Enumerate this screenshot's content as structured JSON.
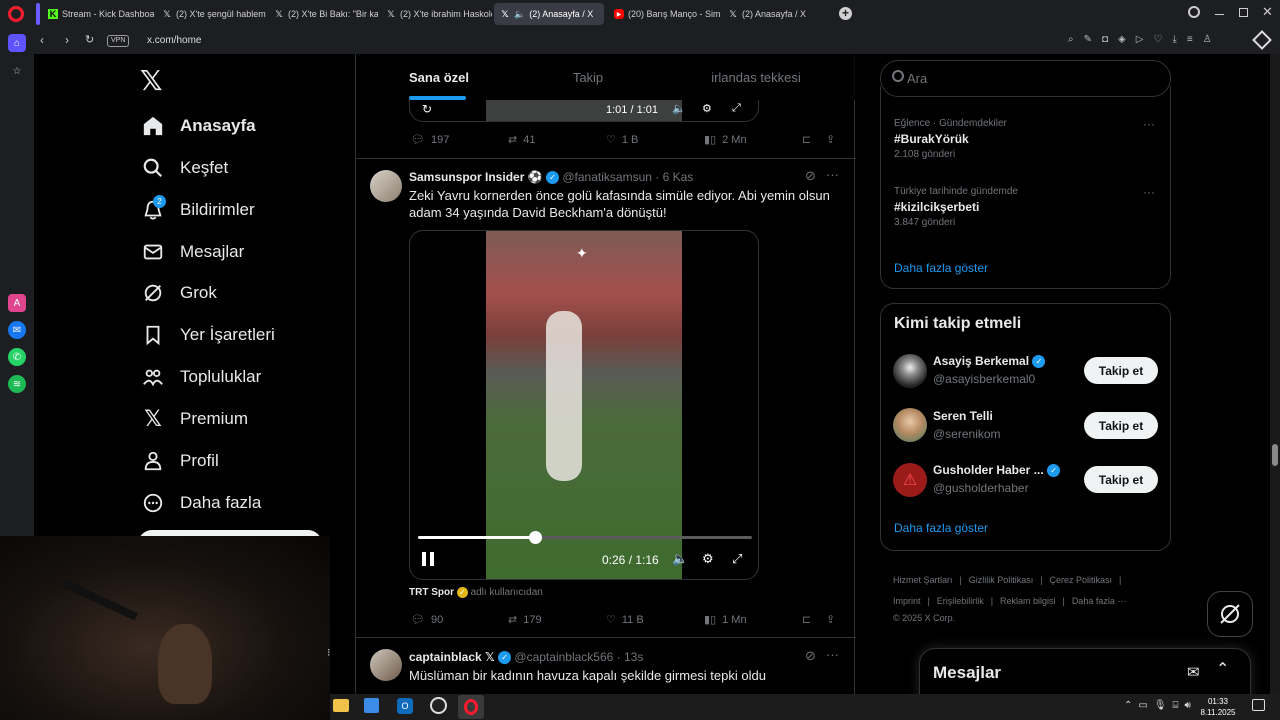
{
  "browser": {
    "tabs": [
      {
        "label": "Stream - Kick Dashboard",
        "icon": "kick-icon",
        "color": "#53fc18"
      },
      {
        "label": "(2) X'te şengül hablemitoğ",
        "icon": "x-icon",
        "color": "#ffffff"
      },
      {
        "label": "(2) X'te Bi Bakı: \"Bir kadın",
        "icon": "x-icon",
        "color": "#ffffff"
      },
      {
        "label": "(2) X'te ibrahim Haskoloğ",
        "icon": "x-icon",
        "color": "#ffffff"
      },
      {
        "label": "(2) Anasayfa / X",
        "icon": "x-icon",
        "color": "#ffffff",
        "active": true
      },
      {
        "label": "(20) Barış Manço - Simsiye",
        "icon": "youtube-icon",
        "color": "#ff0000"
      },
      {
        "label": "(2) Anasayfa / X",
        "icon": "x-icon",
        "color": "#ffffff"
      }
    ],
    "vpn_label": "VPN",
    "url": "x.com/home"
  },
  "nav": {
    "items": [
      {
        "label": "Anasayfa",
        "icon": "home-icon",
        "active": true
      },
      {
        "label": "Keşfet",
        "icon": "search-icon"
      },
      {
        "label": "Bildirimler",
        "icon": "bell-icon",
        "badge": "2"
      },
      {
        "label": "Mesajlar",
        "icon": "mail-icon"
      },
      {
        "label": "Grok",
        "icon": "grok-icon"
      },
      {
        "label": "Yer İşaretleri",
        "icon": "bookmark-icon"
      },
      {
        "label": "Topluluklar",
        "icon": "communities-icon"
      },
      {
        "label": "Premium",
        "icon": "x-logo-icon"
      },
      {
        "label": "Profil",
        "icon": "profile-icon"
      },
      {
        "label": "Daha fazla",
        "icon": "more-circle-icon"
      }
    ]
  },
  "timeline": {
    "tabs": [
      "Sana özel",
      "Takip",
      "irlandas tekkesi"
    ],
    "prev_video_time": "1:01 / 1:01",
    "prev_actions": {
      "replies": "197",
      "reposts": "41",
      "likes": "1 B",
      "views": "2 Mn"
    },
    "tweet": {
      "name": "Samsunspor Insider",
      "handle": "@fanatiksamsun",
      "date": "· 6 Kas",
      "text": "Zeki Yavru kornerden önce golü kafasında simüle ediyor. Abi yemin olsun adam 34 yaşında David Beckham'a dönüştü!",
      "video_time": "0:26 / 1:16",
      "video_progress": 0.35,
      "source_name": "TRT Spor",
      "source_suffix": "adlı kullanıcıdan",
      "actions": {
        "replies": "90",
        "reposts": "179",
        "likes": "11 B",
        "views": "1 Mn"
      }
    },
    "next_tweet": {
      "name": "captainblack",
      "handle": "@captainblack566",
      "date": "· 13s",
      "text": "Müslüman bir kadının havuza kapalı şekilde girmesi tepki oldu"
    }
  },
  "right": {
    "search_placeholder": "Ara",
    "trends": [
      {
        "context": "Eğlence · Gündemdekiler",
        "title": "#BurakYörük",
        "count": "2.108 gönderi"
      },
      {
        "context": "Türkiye tarihinde gündemde",
        "title": "#kizilcikşerbeti",
        "count": "3.847 gönderi"
      }
    ],
    "trends_more": "Daha fazla göster",
    "follow_title": "Kimi takip etmeli",
    "follow": [
      {
        "name": "Asayiş Berkemal",
        "handle": "@asayisberkemal0",
        "verified": true
      },
      {
        "name": "Seren Telli",
        "handle": "@serenikom",
        "verified": false
      },
      {
        "name": "Gusholder Haber ...",
        "handle": "@gusholderhaber",
        "verified": true
      }
    ],
    "follow_button": "Takip et",
    "follow_more": "Daha fazla göster",
    "footer": [
      "Hizmet Şartları",
      "Gizlilik Politikası",
      "Çerez Politikası",
      "Imprint",
      "Erişilebilirlik",
      "Reklam bilgisi",
      "Daha fazla ···"
    ],
    "copyright": "© 2025 X Corp."
  },
  "messages_drawer": {
    "title": "Mesajlar"
  },
  "taskbar": {
    "time": "01:33",
    "date": "8.11.2025"
  }
}
